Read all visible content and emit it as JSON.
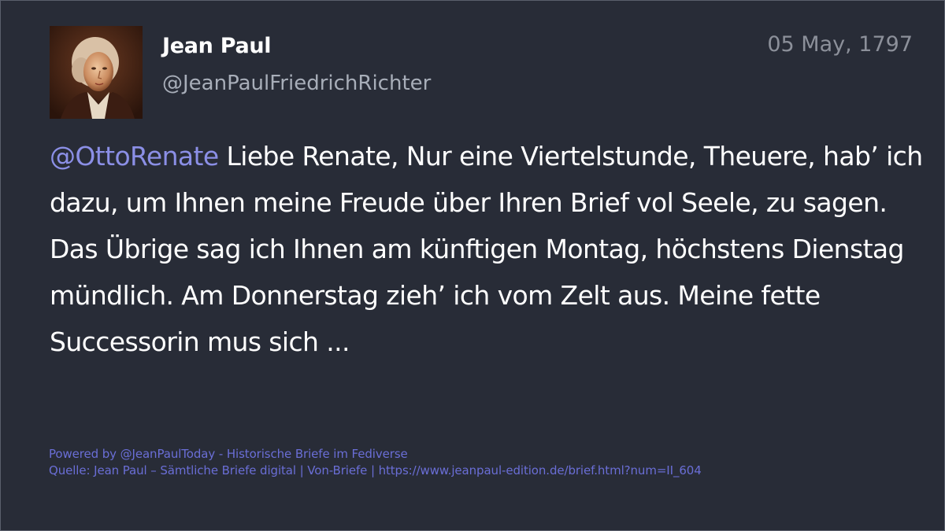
{
  "post": {
    "display_name": "Jean Paul",
    "handle": "@JeanPaulFriedrichRichter",
    "date": "05 May, 1797",
    "mention": "@OttoRenate",
    "body": " Liebe Renate, Nur eine Viertelstunde, Theuere, hab’ ich dazu, um Ihnen meine Freude über Ihren Brief vol Seele, zu sagen. Das Übrige sag ich Ihnen am künftigen Montag, höchstens Dienstag mündlich. Am Donnerstag zieh’ ich vom Zelt aus. Meine fette Successorin mus sich ..."
  },
  "footer": {
    "powered_by": "Powered by @JeanPaulToday - Historische Briefe im Fediverse",
    "source": "Quelle: Jean Paul – Sämtliche Briefe digital | Von-Briefe | https://www.jeanpaul-edition.de/brief.html?num=II_604"
  },
  "colors": {
    "background": "#282c37",
    "name": "#ffffff",
    "handle": "#a8aeb9",
    "mention": "#8b8fe6",
    "footer": "#6a6ed6"
  },
  "avatar": {
    "icon": "portrait-avatar"
  }
}
